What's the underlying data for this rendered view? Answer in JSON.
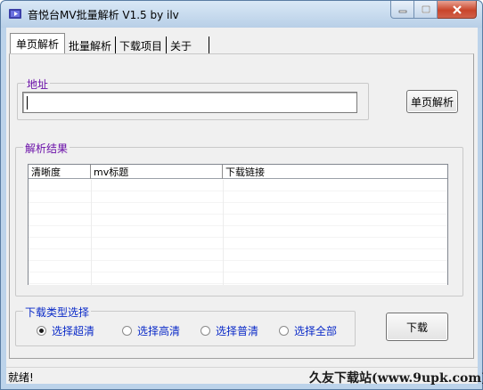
{
  "window": {
    "title": "音悦台MV批量解析 V1.5 by ilv",
    "icon": "music-video-icon"
  },
  "tabs": [
    {
      "label": "单页解析",
      "active": true
    },
    {
      "label": "批量解析",
      "active": false
    },
    {
      "label": "下载项目",
      "active": false
    },
    {
      "label": "关于",
      "active": false
    }
  ],
  "address_group": {
    "label": "地址",
    "input_value": "",
    "parse_button": "单页解析"
  },
  "results_group": {
    "label": "解析结果",
    "columns": [
      "清晰度",
      "mv标题",
      "下载链接"
    ],
    "rows": []
  },
  "download_type_group": {
    "label": "下载类型选择",
    "options": [
      {
        "label": "选择超清",
        "selected": true
      },
      {
        "label": "选择高清",
        "selected": false
      },
      {
        "label": "选择普清",
        "selected": false
      },
      {
        "label": "选择全部",
        "selected": false
      }
    ]
  },
  "download_button": "下载",
  "status": "就绪!",
  "watermark": "久友下载站(www.9upk.com)",
  "colors": {
    "group_label_purple": "#6a0fa8",
    "radio_label_blue": "#0a2ac8",
    "titlebar": "#bcd3ea",
    "close_button": "#c9452b"
  }
}
